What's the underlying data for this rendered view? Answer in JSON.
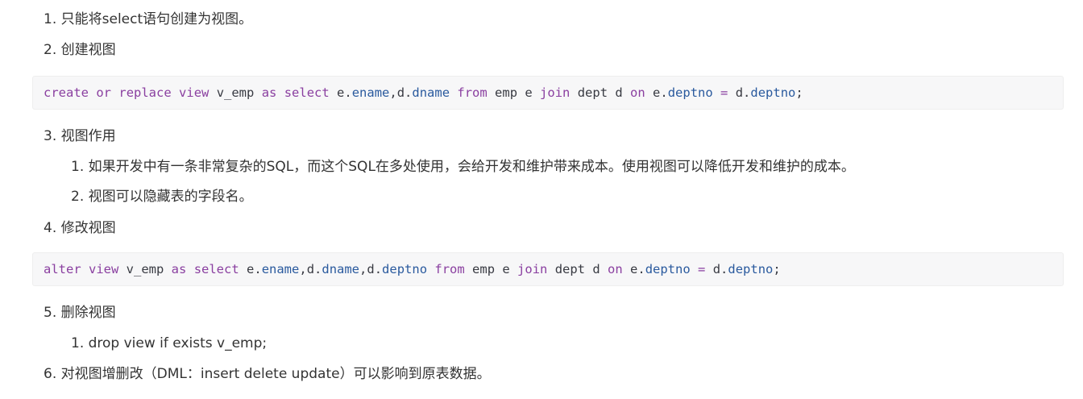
{
  "items": {
    "i1": "1. 只能将select语句创建为视图。",
    "i2": "2. 创建视图",
    "i3": "3. 视图作用",
    "i3_1": "1. 如果开发中有一条非常复杂的SQL，而这个SQL在多处使用，会给开发和维护带来成本。使用视图可以降低开发和维护的成本。",
    "i3_2": "2. 视图可以隐藏表的字段名。",
    "i4": "4. 修改视图",
    "i5": "5. 删除视图",
    "i5_1": "1. drop view if exists v_emp;",
    "i6": "6. 对视图增删改（DML：insert delete update）可以影响到原表数据。"
  },
  "code": {
    "create": [
      {
        "t": "create",
        "c": "kw"
      },
      {
        "t": " ",
        "c": "pl"
      },
      {
        "t": "or",
        "c": "kw"
      },
      {
        "t": " ",
        "c": "pl"
      },
      {
        "t": "replace",
        "c": "kw"
      },
      {
        "t": " ",
        "c": "pl"
      },
      {
        "t": "view",
        "c": "kw"
      },
      {
        "t": " v_emp ",
        "c": "pl"
      },
      {
        "t": "as",
        "c": "kw"
      },
      {
        "t": " ",
        "c": "pl"
      },
      {
        "t": "select",
        "c": "kw"
      },
      {
        "t": " e.",
        "c": "pl"
      },
      {
        "t": "ename",
        "c": "pr"
      },
      {
        "t": ",d.",
        "c": "pl"
      },
      {
        "t": "dname",
        "c": "pr"
      },
      {
        "t": " ",
        "c": "pl"
      },
      {
        "t": "from",
        "c": "kw"
      },
      {
        "t": " emp e ",
        "c": "pl"
      },
      {
        "t": "join",
        "c": "kw"
      },
      {
        "t": " dept d ",
        "c": "pl"
      },
      {
        "t": "on",
        "c": "kw"
      },
      {
        "t": " e.",
        "c": "pl"
      },
      {
        "t": "deptno",
        "c": "pr"
      },
      {
        "t": " ",
        "c": "pl"
      },
      {
        "t": "=",
        "c": "kw"
      },
      {
        "t": " d.",
        "c": "pl"
      },
      {
        "t": "deptno",
        "c": "pr"
      },
      {
        "t": ";",
        "c": "pl"
      }
    ],
    "alter": [
      {
        "t": "alter",
        "c": "kw"
      },
      {
        "t": " ",
        "c": "pl"
      },
      {
        "t": "view",
        "c": "kw"
      },
      {
        "t": " v_emp ",
        "c": "pl"
      },
      {
        "t": "as",
        "c": "kw"
      },
      {
        "t": " ",
        "c": "pl"
      },
      {
        "t": "select",
        "c": "kw"
      },
      {
        "t": " e.",
        "c": "pl"
      },
      {
        "t": "ename",
        "c": "pr"
      },
      {
        "t": ",d.",
        "c": "pl"
      },
      {
        "t": "dname",
        "c": "pr"
      },
      {
        "t": ",d.",
        "c": "pl"
      },
      {
        "t": "deptno",
        "c": "pr"
      },
      {
        "t": " ",
        "c": "pl"
      },
      {
        "t": "from",
        "c": "kw"
      },
      {
        "t": " emp e ",
        "c": "pl"
      },
      {
        "t": "join",
        "c": "kw"
      },
      {
        "t": " dept d ",
        "c": "pl"
      },
      {
        "t": "on",
        "c": "kw"
      },
      {
        "t": " e.",
        "c": "pl"
      },
      {
        "t": "deptno",
        "c": "pr"
      },
      {
        "t": " ",
        "c": "pl"
      },
      {
        "t": "=",
        "c": "kw"
      },
      {
        "t": " d.",
        "c": "pl"
      },
      {
        "t": "deptno",
        "c": "pr"
      },
      {
        "t": ";",
        "c": "pl"
      }
    ]
  },
  "colors": {
    "keyword": "#8a3fa0",
    "property": "#2a5a9e",
    "plain": "#383a42",
    "code_background": "#f7f7f8",
    "text": "#333333"
  }
}
